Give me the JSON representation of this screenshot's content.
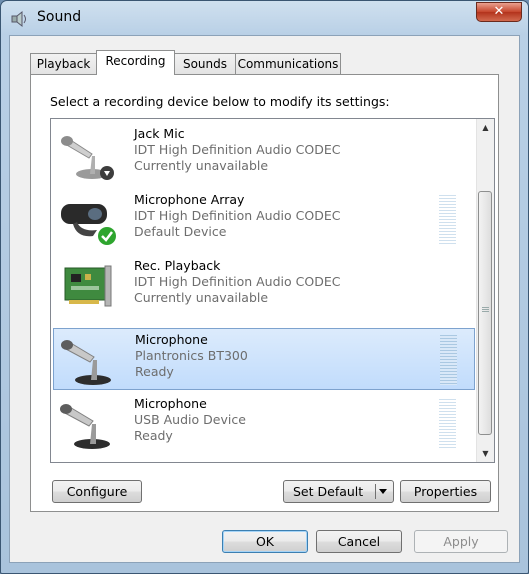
{
  "window": {
    "title": "Sound",
    "close_glyph": "✕"
  },
  "tabs": [
    {
      "label": "Playback",
      "active": false
    },
    {
      "label": "Recording",
      "active": true
    },
    {
      "label": "Sounds",
      "active": false
    },
    {
      "label": "Communications",
      "active": false
    }
  ],
  "instruction": "Select a recording device below to modify its settings:",
  "devices": [
    {
      "name": "Jack Mic",
      "driver": "IDT High Definition Audio CODEC",
      "state": "Currently unavailable",
      "icon": "microphone-icon",
      "selected": false,
      "meter": false
    },
    {
      "name": "Microphone Array",
      "driver": "IDT High Definition Audio CODEC",
      "state": "Default Device",
      "icon": "webcam-microphone-icon",
      "selected": false,
      "meter": true
    },
    {
      "name": "Rec. Playback",
      "driver": "IDT High Definition Audio CODEC",
      "state": "Currently unavailable",
      "icon": "sound-card-icon",
      "selected": false,
      "meter": false
    },
    {
      "name": "Microphone",
      "driver": "Plantronics BT300",
      "state": "Ready",
      "icon": "microphone-icon",
      "selected": true,
      "meter": true
    },
    {
      "name": "Microphone",
      "driver": "USB Audio Device",
      "state": "Ready",
      "icon": "microphone-icon",
      "selected": false,
      "meter": true
    }
  ],
  "buttons": {
    "configure": "Configure",
    "set_default": "Set Default",
    "properties": "Properties",
    "ok": "OK",
    "cancel": "Cancel",
    "apply": "Apply"
  },
  "colors": {
    "selection": "#c1dcfc",
    "close_button": "#c5452b",
    "default_check": "#2ea52e"
  }
}
